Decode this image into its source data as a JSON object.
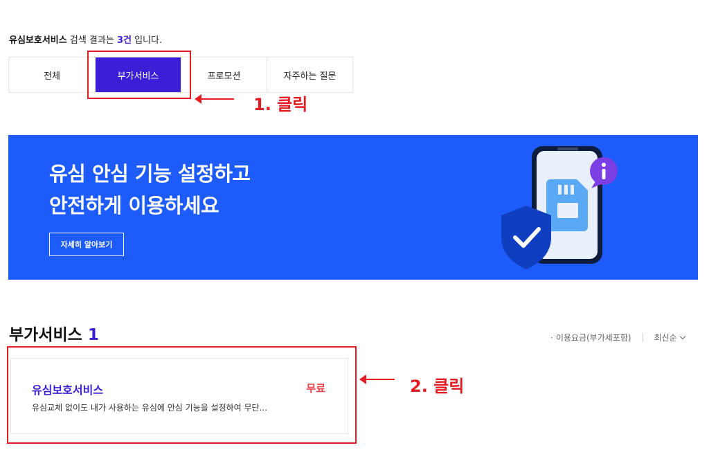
{
  "search_result": {
    "keyword": "유심보호서비스",
    "text_before_count": " 검색 결과는 ",
    "count": "3건",
    "text_after_count": " 입니다."
  },
  "tabs": [
    {
      "label": "전체",
      "active": false
    },
    {
      "label": "부가서비스",
      "active": true
    },
    {
      "label": "프로모션",
      "active": false
    },
    {
      "label": "자주하는 질문",
      "active": false
    }
  ],
  "annotations": {
    "step1": "1. 클릭",
    "step2": "2. 클릭",
    "color": "#e41b23"
  },
  "banner": {
    "title_line1": "유심 안심 기능 설정하고",
    "title_line2": "안전하게 이용하세요",
    "button_label": "자세히 알아보기",
    "background": "#1d5cfb"
  },
  "section": {
    "title": "부가서비스",
    "count": "1"
  },
  "filters": {
    "price_filter": "이용요금(부가세포함)",
    "sort_label": "최신순"
  },
  "service_card": {
    "title": "유심보호서비스",
    "price": "무료",
    "description": "유심교체 없이도 내가 사용하는 유심에 안심 기능을 설정하여 무단..."
  },
  "colors": {
    "accent": "#3a1fd6",
    "price_red": "#e8424a"
  }
}
